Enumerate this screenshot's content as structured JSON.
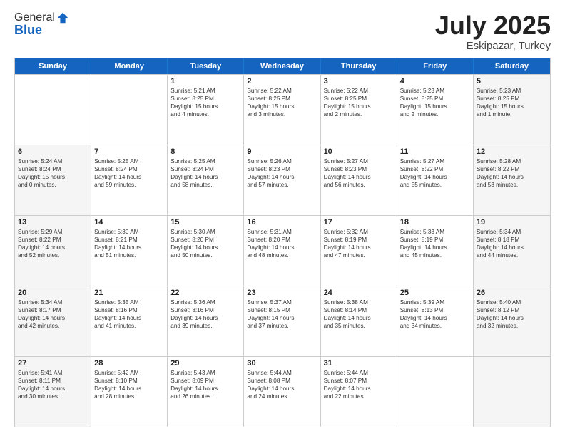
{
  "logo": {
    "general": "General",
    "blue": "Blue"
  },
  "header": {
    "month": "July 2025",
    "location": "Eskipazar, Turkey"
  },
  "weekdays": [
    "Sunday",
    "Monday",
    "Tuesday",
    "Wednesday",
    "Thursday",
    "Friday",
    "Saturday"
  ],
  "rows": [
    [
      {
        "day": "",
        "lines": [],
        "shaded": false
      },
      {
        "day": "",
        "lines": [],
        "shaded": false
      },
      {
        "day": "1",
        "lines": [
          "Sunrise: 5:21 AM",
          "Sunset: 8:25 PM",
          "Daylight: 15 hours",
          "and 4 minutes."
        ],
        "shaded": false
      },
      {
        "day": "2",
        "lines": [
          "Sunrise: 5:22 AM",
          "Sunset: 8:25 PM",
          "Daylight: 15 hours",
          "and 3 minutes."
        ],
        "shaded": false
      },
      {
        "day": "3",
        "lines": [
          "Sunrise: 5:22 AM",
          "Sunset: 8:25 PM",
          "Daylight: 15 hours",
          "and 2 minutes."
        ],
        "shaded": false
      },
      {
        "day": "4",
        "lines": [
          "Sunrise: 5:23 AM",
          "Sunset: 8:25 PM",
          "Daylight: 15 hours",
          "and 2 minutes."
        ],
        "shaded": false
      },
      {
        "day": "5",
        "lines": [
          "Sunrise: 5:23 AM",
          "Sunset: 8:25 PM",
          "Daylight: 15 hours",
          "and 1 minute."
        ],
        "shaded": true
      }
    ],
    [
      {
        "day": "6",
        "lines": [
          "Sunrise: 5:24 AM",
          "Sunset: 8:24 PM",
          "Daylight: 15 hours",
          "and 0 minutes."
        ],
        "shaded": true
      },
      {
        "day": "7",
        "lines": [
          "Sunrise: 5:25 AM",
          "Sunset: 8:24 PM",
          "Daylight: 14 hours",
          "and 59 minutes."
        ],
        "shaded": false
      },
      {
        "day": "8",
        "lines": [
          "Sunrise: 5:25 AM",
          "Sunset: 8:24 PM",
          "Daylight: 14 hours",
          "and 58 minutes."
        ],
        "shaded": false
      },
      {
        "day": "9",
        "lines": [
          "Sunrise: 5:26 AM",
          "Sunset: 8:23 PM",
          "Daylight: 14 hours",
          "and 57 minutes."
        ],
        "shaded": false
      },
      {
        "day": "10",
        "lines": [
          "Sunrise: 5:27 AM",
          "Sunset: 8:23 PM",
          "Daylight: 14 hours",
          "and 56 minutes."
        ],
        "shaded": false
      },
      {
        "day": "11",
        "lines": [
          "Sunrise: 5:27 AM",
          "Sunset: 8:22 PM",
          "Daylight: 14 hours",
          "and 55 minutes."
        ],
        "shaded": false
      },
      {
        "day": "12",
        "lines": [
          "Sunrise: 5:28 AM",
          "Sunset: 8:22 PM",
          "Daylight: 14 hours",
          "and 53 minutes."
        ],
        "shaded": true
      }
    ],
    [
      {
        "day": "13",
        "lines": [
          "Sunrise: 5:29 AM",
          "Sunset: 8:22 PM",
          "Daylight: 14 hours",
          "and 52 minutes."
        ],
        "shaded": true
      },
      {
        "day": "14",
        "lines": [
          "Sunrise: 5:30 AM",
          "Sunset: 8:21 PM",
          "Daylight: 14 hours",
          "and 51 minutes."
        ],
        "shaded": false
      },
      {
        "day": "15",
        "lines": [
          "Sunrise: 5:30 AM",
          "Sunset: 8:20 PM",
          "Daylight: 14 hours",
          "and 50 minutes."
        ],
        "shaded": false
      },
      {
        "day": "16",
        "lines": [
          "Sunrise: 5:31 AM",
          "Sunset: 8:20 PM",
          "Daylight: 14 hours",
          "and 48 minutes."
        ],
        "shaded": false
      },
      {
        "day": "17",
        "lines": [
          "Sunrise: 5:32 AM",
          "Sunset: 8:19 PM",
          "Daylight: 14 hours",
          "and 47 minutes."
        ],
        "shaded": false
      },
      {
        "day": "18",
        "lines": [
          "Sunrise: 5:33 AM",
          "Sunset: 8:19 PM",
          "Daylight: 14 hours",
          "and 45 minutes."
        ],
        "shaded": false
      },
      {
        "day": "19",
        "lines": [
          "Sunrise: 5:34 AM",
          "Sunset: 8:18 PM",
          "Daylight: 14 hours",
          "and 44 minutes."
        ],
        "shaded": true
      }
    ],
    [
      {
        "day": "20",
        "lines": [
          "Sunrise: 5:34 AM",
          "Sunset: 8:17 PM",
          "Daylight: 14 hours",
          "and 42 minutes."
        ],
        "shaded": true
      },
      {
        "day": "21",
        "lines": [
          "Sunrise: 5:35 AM",
          "Sunset: 8:16 PM",
          "Daylight: 14 hours",
          "and 41 minutes."
        ],
        "shaded": false
      },
      {
        "day": "22",
        "lines": [
          "Sunrise: 5:36 AM",
          "Sunset: 8:16 PM",
          "Daylight: 14 hours",
          "and 39 minutes."
        ],
        "shaded": false
      },
      {
        "day": "23",
        "lines": [
          "Sunrise: 5:37 AM",
          "Sunset: 8:15 PM",
          "Daylight: 14 hours",
          "and 37 minutes."
        ],
        "shaded": false
      },
      {
        "day": "24",
        "lines": [
          "Sunrise: 5:38 AM",
          "Sunset: 8:14 PM",
          "Daylight: 14 hours",
          "and 35 minutes."
        ],
        "shaded": false
      },
      {
        "day": "25",
        "lines": [
          "Sunrise: 5:39 AM",
          "Sunset: 8:13 PM",
          "Daylight: 14 hours",
          "and 34 minutes."
        ],
        "shaded": false
      },
      {
        "day": "26",
        "lines": [
          "Sunrise: 5:40 AM",
          "Sunset: 8:12 PM",
          "Daylight: 14 hours",
          "and 32 minutes."
        ],
        "shaded": true
      }
    ],
    [
      {
        "day": "27",
        "lines": [
          "Sunrise: 5:41 AM",
          "Sunset: 8:11 PM",
          "Daylight: 14 hours",
          "and 30 minutes."
        ],
        "shaded": true
      },
      {
        "day": "28",
        "lines": [
          "Sunrise: 5:42 AM",
          "Sunset: 8:10 PM",
          "Daylight: 14 hours",
          "and 28 minutes."
        ],
        "shaded": false
      },
      {
        "day": "29",
        "lines": [
          "Sunrise: 5:43 AM",
          "Sunset: 8:09 PM",
          "Daylight: 14 hours",
          "and 26 minutes."
        ],
        "shaded": false
      },
      {
        "day": "30",
        "lines": [
          "Sunrise: 5:44 AM",
          "Sunset: 8:08 PM",
          "Daylight: 14 hours",
          "and 24 minutes."
        ],
        "shaded": false
      },
      {
        "day": "31",
        "lines": [
          "Sunrise: 5:44 AM",
          "Sunset: 8:07 PM",
          "Daylight: 14 hours",
          "and 22 minutes."
        ],
        "shaded": false
      },
      {
        "day": "",
        "lines": [],
        "shaded": false
      },
      {
        "day": "",
        "lines": [],
        "shaded": true
      }
    ]
  ]
}
